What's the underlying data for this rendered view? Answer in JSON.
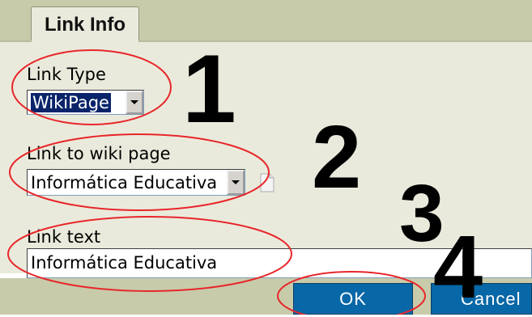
{
  "tabs": [
    {
      "label": "Link Info"
    }
  ],
  "fields": {
    "link_type": {
      "label": "Link Type",
      "value": "WikiPage"
    },
    "wiki_page": {
      "label": "Link to wiki page",
      "value": "Informática Educativa"
    },
    "link_text": {
      "label": "Link text",
      "value": "Informática Educativa"
    }
  },
  "buttons": {
    "ok": "OK",
    "cancel": "Cancel"
  },
  "annotations": {
    "step1": "1",
    "step2": "2",
    "step3": "3",
    "step4": "4"
  },
  "colors": {
    "annotation_ellipse": "#e8262a",
    "button_bg": "#0867a6",
    "frame": "#c7cbaa"
  }
}
